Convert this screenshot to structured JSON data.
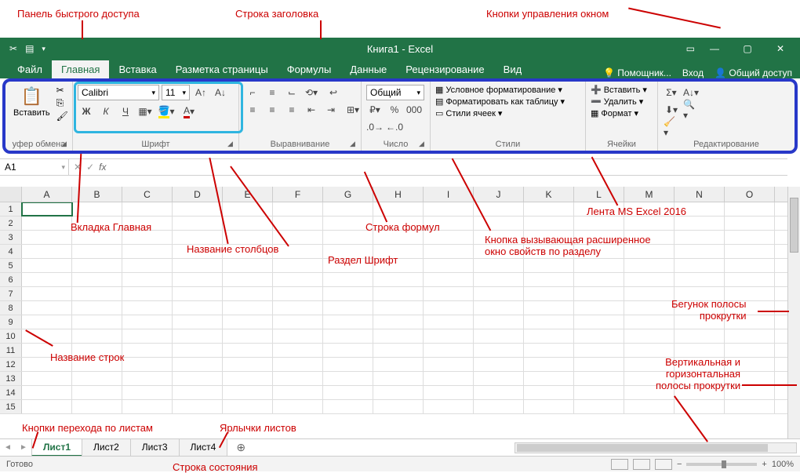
{
  "annotations": {
    "qat": "Панель быстрого доступа",
    "titlebar": "Строка заголовка",
    "winbtns": "Кнопки управления окном",
    "hometab": "Вкладка Главная",
    "colnames": "Название столбцов",
    "fontsec": "Раздел Шрифт",
    "formulabar": "Строка формул",
    "launcher": "Кнопка вызывающая расширенное\nокно свойств по разделу",
    "ribbon": "Лента MS Excel 2016",
    "rownames": "Название строк",
    "sheetnav": "Кнопки перехода по листам",
    "sheettabs": "Ярлычки листов",
    "statusbar": "Строка состояния",
    "scrollthumb": "Бегунок полосы\nпрокрутки",
    "scrollbars": "Вертикальная и\nгоризонтальная\nполосы прокрутки"
  },
  "title": "Книга1 - Excel",
  "tabs": [
    "Файл",
    "Главная",
    "Вставка",
    "Разметка страницы",
    "Формулы",
    "Данные",
    "Рецензирование",
    "Вид"
  ],
  "tabs_right": {
    "help": "Помощник...",
    "signin": "Вход",
    "share": "Общий доступ"
  },
  "ribbon": {
    "clipboard": {
      "paste": "Вставить",
      "label": "уфер обмена"
    },
    "font": {
      "name": "Calibri",
      "size": "11",
      "bold": "Ж",
      "italic": "К",
      "underline": "Ч",
      "label": "Шрифт"
    },
    "align": {
      "label": "Выравнивание"
    },
    "number": {
      "format": "Общий",
      "label": "Число"
    },
    "styles": {
      "cond": "Условное форматирование",
      "table": "Форматировать как таблицу",
      "cell": "Стили ячеек",
      "label": "Стили"
    },
    "cells": {
      "insert": "Вставить",
      "delete": "Удалить",
      "format": "Формат",
      "label": "Ячейки"
    },
    "editing": {
      "label": "Редактирование"
    }
  },
  "namebox": "A1",
  "columns": [
    "A",
    "B",
    "C",
    "D",
    "E",
    "F",
    "G",
    "H",
    "I",
    "J",
    "K",
    "L",
    "M",
    "N",
    "O"
  ],
  "rows": [
    "1",
    "2",
    "3",
    "4",
    "5",
    "6",
    "7",
    "8",
    "9",
    "10",
    "11",
    "12",
    "13",
    "14",
    "15"
  ],
  "sheets": [
    "Лист1",
    "Лист2",
    "Лист3",
    "Лист4"
  ],
  "status": {
    "ready": "Готово",
    "zoom": "100%"
  }
}
